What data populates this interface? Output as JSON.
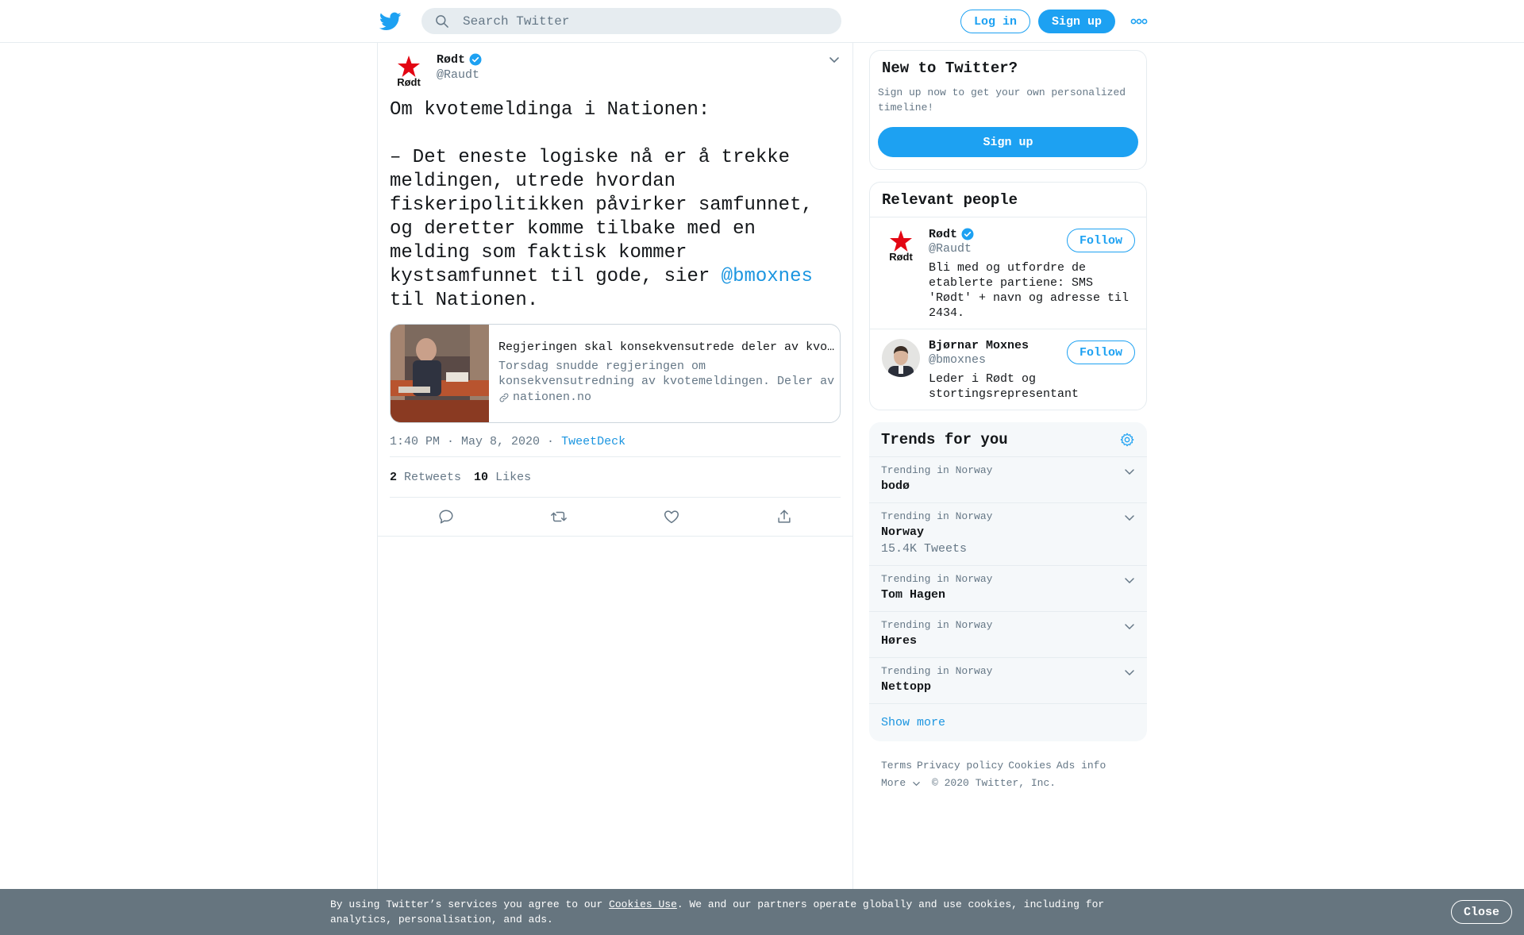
{
  "header": {
    "search_placeholder": "Search Twitter",
    "login_label": "Log in",
    "signup_label": "Sign up"
  },
  "tweet": {
    "author_name": "Rødt",
    "author_handle": "@Raudt",
    "text_before": "Om kvotemeldinga i Nationen:\n\n– Det eneste logiske nå er å trekke meldingen, utrede hvordan fiskeripolitikken påvirker samfunnet, og deretter komme tilbake med en melding som faktisk kommer kystsamfunnet til gode, sier ",
    "mention": "@bmoxnes",
    "text_after": " til Nationen.",
    "card": {
      "title": "Regjeringen skal konsekvensutrede deler av kvotemeldingen",
      "description": "Torsdag snudde regjeringen om konsekvensutredning av kvotemeldingen. Deler av meldingen skal nå utredes.",
      "domain": "nationen.no"
    },
    "timestamp": "1:40 PM · May 8, 2020",
    "separator": "·",
    "source": "TweetDeck",
    "retweets_count": "2",
    "retweets_label": "Retweets",
    "likes_count": "10",
    "likes_label": "Likes"
  },
  "new_to_twitter": {
    "title": "New to Twitter?",
    "subtitle": "Sign up now to get your own personalized timeline!",
    "button": "Sign up"
  },
  "relevant_people": {
    "title": "Relevant people",
    "people": [
      {
        "name": "Rødt",
        "handle": "@Raudt",
        "bio": "Bli med og utfordre de etablerte partiene: SMS 'Rødt' + navn og adresse til 2434.",
        "follow_label": "Follow"
      },
      {
        "name": "Bjørnar Moxnes",
        "handle": "@bmoxnes",
        "bio": "Leder i Rødt og stortingsrepresentant",
        "follow_label": "Follow"
      }
    ]
  },
  "trends": {
    "title": "Trends for you",
    "items": [
      {
        "context": "Trending in Norway",
        "name": "bodø",
        "count": ""
      },
      {
        "context": "Trending in Norway",
        "name": "Norway",
        "count": "15.4K Tweets"
      },
      {
        "context": "Trending in Norway",
        "name": "Tom Hagen",
        "count": ""
      },
      {
        "context": "Trending in Norway",
        "name": "Høres",
        "count": ""
      },
      {
        "context": "Trending in Norway",
        "name": "Nettopp",
        "count": ""
      }
    ],
    "show_more": "Show more"
  },
  "footer": {
    "links": [
      "Terms",
      "Privacy policy",
      "Cookies",
      "Ads info"
    ],
    "more": "More",
    "copyright": "© 2020 Twitter, Inc."
  },
  "cookie_banner": {
    "text_before": "By using Twitter’s services you agree to our ",
    "link": "Cookies Use",
    "text_after": ". We and our partners operate globally and use cookies, including for analytics, personalisation, and ads.",
    "close_label": "Close"
  },
  "colors": {
    "brand_blue": "#1da1f2",
    "link_blue": "#1b95e0",
    "muted_text": "#657786",
    "banner_bg": "#66757f",
    "rodt_red": "#e30613"
  }
}
